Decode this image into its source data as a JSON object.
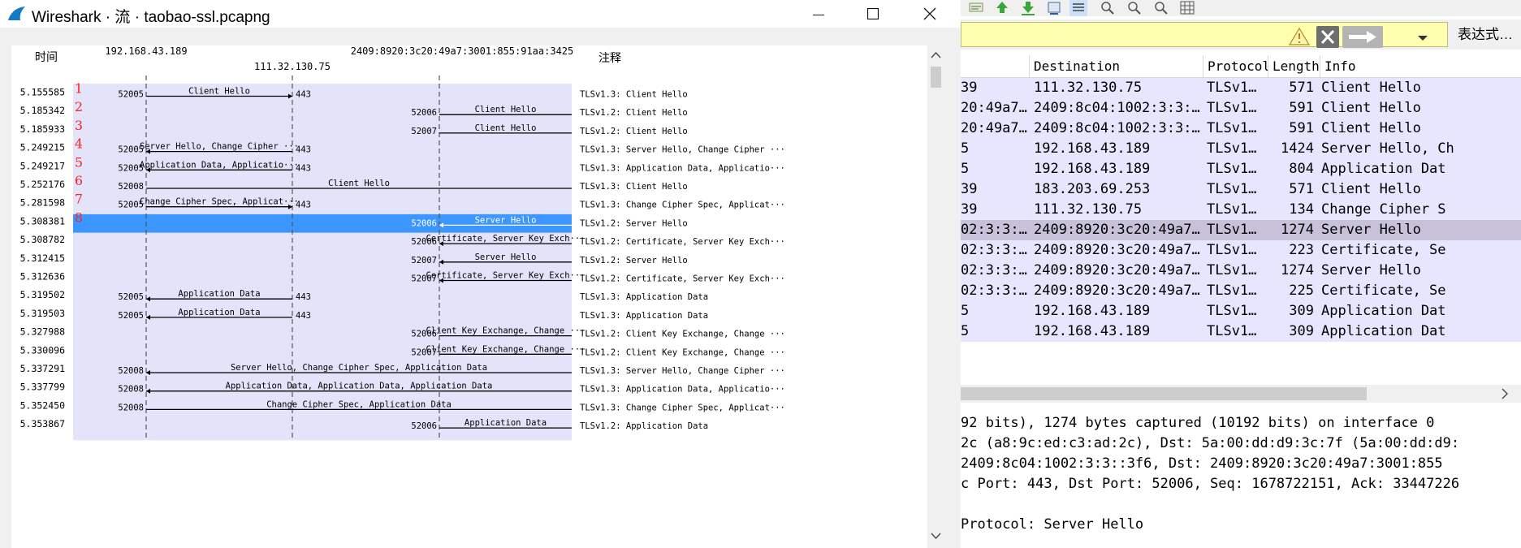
{
  "flow_window": {
    "app_name": "Wireshark",
    "title_separator1": " · ",
    "title_mid": "流",
    "title_separator2": " · ",
    "file_name": "taobao-ssl.pcapng",
    "minimize_glyph": "—"
  },
  "flow_graph": {
    "time_header": "时间",
    "comment_header": "注释",
    "nodes": [
      {
        "addr": "192.168.43.189"
      },
      {
        "addr": "111.32.130.75"
      },
      {
        "addr": "2409:8920:3c20:49a7:3001:855:91aa:3425"
      }
    ],
    "colors": {
      "band": "#e3e3fa",
      "selected": "#3c96ff",
      "marker": "#ff2222"
    },
    "selected_index": 7,
    "rows": [
      {
        "n": "1",
        "time": "5.155585",
        "from": 0,
        "to": 1,
        "src_port": "52005",
        "dst_port": "443",
        "label": "Client Hello",
        "comment": "TLSv1.3: Client Hello"
      },
      {
        "n": "2",
        "time": "5.185342",
        "from": 2,
        "to": 3,
        "src_port": "52006",
        "dst_port": "",
        "label": "Client Hello",
        "comment": "TLSv1.2: Client Hello"
      },
      {
        "n": "3",
        "time": "5.185933",
        "from": 2,
        "to": 3,
        "src_port": "52007",
        "dst_port": "",
        "label": "Client Hello",
        "comment": "TLSv1.2: Client Hello"
      },
      {
        "n": "4",
        "time": "5.249215",
        "from": 1,
        "to": 0,
        "src_port": "52005",
        "dst_port": "443",
        "label": "Server Hello, Change Cipher ···",
        "comment": "TLSv1.3: Server Hello, Change Cipher ···"
      },
      {
        "n": "5",
        "time": "5.249217",
        "from": 1,
        "to": 0,
        "src_port": "52005",
        "dst_port": "443",
        "label": "Application Data, Applicatio···",
        "comment": "TLSv1.3: Application Data, Applicatio···"
      },
      {
        "n": "6",
        "time": "5.252176",
        "from": 0,
        "to": 3,
        "src_port": "52008",
        "dst_port": "",
        "label": "Client Hello",
        "comment": "TLSv1.3: Client Hello"
      },
      {
        "n": "7",
        "time": "5.281598",
        "from": 0,
        "to": 1,
        "src_port": "52005",
        "dst_port": "443",
        "label": "Change Cipher Spec, Applicat···",
        "comment": "TLSv1.3: Change Cipher Spec, Applicat···"
      },
      {
        "n": "8",
        "time": "5.308381",
        "from": 3,
        "to": 2,
        "src_port": "52006",
        "dst_port": "",
        "label": "Server Hello",
        "comment": "TLSv1.2: Server Hello"
      },
      {
        "n": "",
        "time": "5.308782",
        "from": 3,
        "to": 2,
        "src_port": "52006",
        "dst_port": "",
        "label": "Certificate, Server Key Exch···",
        "comment": "TLSv1.2: Certificate, Server Key Exch···"
      },
      {
        "n": "",
        "time": "5.312415",
        "from": 3,
        "to": 2,
        "src_port": "52007",
        "dst_port": "",
        "label": "Server Hello",
        "comment": "TLSv1.2: Server Hello"
      },
      {
        "n": "",
        "time": "5.312636",
        "from": 3,
        "to": 2,
        "src_port": "52007",
        "dst_port": "",
        "label": "Certificate, Server Key Exch···",
        "comment": "TLSv1.2: Certificate, Server Key Exch···"
      },
      {
        "n": "",
        "time": "5.319502",
        "from": 1,
        "to": 0,
        "src_port": "52005",
        "dst_port": "443",
        "label": "Application Data",
        "comment": "TLSv1.3: Application Data"
      },
      {
        "n": "",
        "time": "5.319503",
        "from": 1,
        "to": 0,
        "src_port": "52005",
        "dst_port": "443",
        "label": "Application Data",
        "comment": "TLSv1.3: Application Data"
      },
      {
        "n": "",
        "time": "5.327988",
        "from": 2,
        "to": 3,
        "src_port": "52006",
        "dst_port": "",
        "label": "Client Key Exchange, Change ···",
        "comment": "TLSv1.2: Client Key Exchange, Change ···"
      },
      {
        "n": "",
        "time": "5.330096",
        "from": 2,
        "to": 3,
        "src_port": "52007",
        "dst_port": "",
        "label": "Client Key Exchange, Change ···",
        "comment": "TLSv1.2: Client Key Exchange, Change ···"
      },
      {
        "n": "",
        "time": "5.337291",
        "from": 3,
        "to": 0,
        "src_port": "52008",
        "dst_port": "",
        "label": "Server Hello, Change Cipher Spec, Application Data",
        "comment": "TLSv1.3: Server Hello, Change Cipher ···"
      },
      {
        "n": "",
        "time": "5.337799",
        "from": 3,
        "to": 0,
        "src_port": "52008",
        "dst_port": "",
        "label": "Application Data, Application Data, Application Data",
        "comment": "TLSv1.3: Application Data, Applicatio···"
      },
      {
        "n": "",
        "time": "5.352450",
        "from": 0,
        "to": 3,
        "src_port": "52008",
        "dst_port": "",
        "label": "Change Cipher Spec, Application Data",
        "comment": "TLSv1.3: Change Cipher Spec, Applicat···"
      },
      {
        "n": "",
        "time": "5.353867",
        "from": 2,
        "to": 3,
        "src_port": "52006",
        "dst_port": "",
        "label": "Application Data",
        "comment": "TLSv1.2: Application Data"
      }
    ]
  },
  "main_window": {
    "filter": {
      "expression_button": "表达式…"
    },
    "packet_list": {
      "columns": [
        "Destination",
        "Protocol",
        "Length",
        "Info"
      ],
      "selected_index": 7,
      "rows": [
        {
          "src": "39",
          "dst": "111.32.130.75",
          "proto": "TLSv1…",
          "len": "571",
          "info": "Client Hello"
        },
        {
          "src": "20:49a7…",
          "dst": "2409:8c04:1002:3:3:…",
          "proto": "TLSv1…",
          "len": "591",
          "info": "Client Hello"
        },
        {
          "src": "20:49a7…",
          "dst": "2409:8c04:1002:3:3:…",
          "proto": "TLSv1…",
          "len": "591",
          "info": "Client Hello"
        },
        {
          "src": "5",
          "dst": "192.168.43.189",
          "proto": "TLSv1…",
          "len": "1424",
          "info": "Server Hello, Ch"
        },
        {
          "src": "5",
          "dst": "192.168.43.189",
          "proto": "TLSv1…",
          "len": "804",
          "info": "Application Dat"
        },
        {
          "src": "39",
          "dst": "183.203.69.253",
          "proto": "TLSv1…",
          "len": "571",
          "info": "Client Hello"
        },
        {
          "src": "39",
          "dst": "111.32.130.75",
          "proto": "TLSv1…",
          "len": "134",
          "info": "Change Cipher S"
        },
        {
          "src": "02:3:3:…",
          "dst": "2409:8920:3c20:49a7…",
          "proto": "TLSv1…",
          "len": "1274",
          "info": "Server Hello"
        },
        {
          "src": "02:3:3:…",
          "dst": "2409:8920:3c20:49a7…",
          "proto": "TLSv1…",
          "len": "223",
          "info": "Certificate, Se"
        },
        {
          "src": "02:3:3:…",
          "dst": "2409:8920:3c20:49a7…",
          "proto": "TLSv1…",
          "len": "1274",
          "info": "Server Hello"
        },
        {
          "src": "02:3:3:…",
          "dst": "2409:8920:3c20:49a7…",
          "proto": "TLSv1…",
          "len": "225",
          "info": "Certificate, Se"
        },
        {
          "src": "5",
          "dst": "192.168.43.189",
          "proto": "TLSv1…",
          "len": "309",
          "info": "Application Dat"
        },
        {
          "src": "5",
          "dst": "192.168.43.189",
          "proto": "TLSv1…",
          "len": "309",
          "info": "Application Dat"
        }
      ]
    },
    "details": [
      "92 bits), 1274 bytes captured (10192 bits) on interface 0",
      "2c (a8:9c:ed:c3:ad:2c), Dst: 5a:00:dd:d9:3c:7f (5a:00:dd:d9:",
      " 2409:8c04:1002:3:3::3f6, Dst: 2409:8920:3c20:49a7:3001:855",
      "c Port: 443, Dst Port: 52006, Seq: 1678722151, Ack: 33447226",
      "",
      "  Protocol: Server Hello"
    ]
  }
}
